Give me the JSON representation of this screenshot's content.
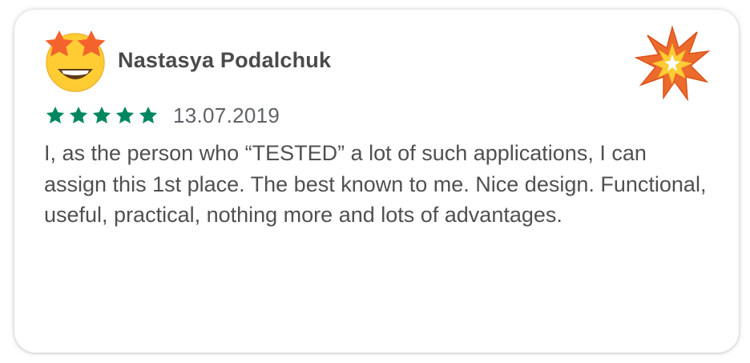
{
  "review": {
    "reviewer_name": "Nastasya Podalchuk",
    "avatar_icon": "star-struck-emoji-icon",
    "badge_icon": "collision-burst-icon",
    "rating": 5,
    "rating_max": 5,
    "date": "13.07.2019",
    "text": "I, as the person who “TESTED” a lot of such applications, I can assign this 1st place. The best known to me. Nice design. Functional, useful, practical, nothing more and lots of advantages."
  },
  "colors": {
    "star": "#01875f",
    "name": "#4a4a4a",
    "body_text": "#505050",
    "date": "#5f6368",
    "emoji_face": "#ffcc33",
    "emoji_stars": "#f4622d",
    "burst_outer": "#ec6a2b",
    "burst_inner": "#ffcc33"
  }
}
